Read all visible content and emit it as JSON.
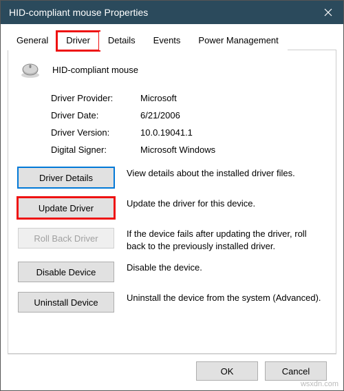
{
  "window": {
    "title": "HID-compliant mouse Properties"
  },
  "tabs": {
    "items": [
      "General",
      "Driver",
      "Details",
      "Events",
      "Power Management"
    ],
    "active_index": 1
  },
  "device": {
    "name": "HID-compliant mouse"
  },
  "info": {
    "provider_label": "Driver Provider:",
    "provider_value": "Microsoft",
    "date_label": "Driver Date:",
    "date_value": "6/21/2006",
    "version_label": "Driver Version:",
    "version_value": "10.0.19041.1",
    "signer_label": "Digital Signer:",
    "signer_value": "Microsoft Windows"
  },
  "buttons": {
    "details": {
      "label": "Driver Details",
      "desc": "View details about the installed driver files."
    },
    "update": {
      "label": "Update Driver",
      "desc": "Update the driver for this device."
    },
    "rollback": {
      "label": "Roll Back Driver",
      "desc": "If the device fails after updating the driver, roll back to the previously installed driver."
    },
    "disable": {
      "label": "Disable Device",
      "desc": "Disable the device."
    },
    "uninstall": {
      "label": "Uninstall Device",
      "desc": "Uninstall the device from the system (Advanced)."
    }
  },
  "footer": {
    "ok": "OK",
    "cancel": "Cancel"
  },
  "watermark": "wsxdn.com"
}
